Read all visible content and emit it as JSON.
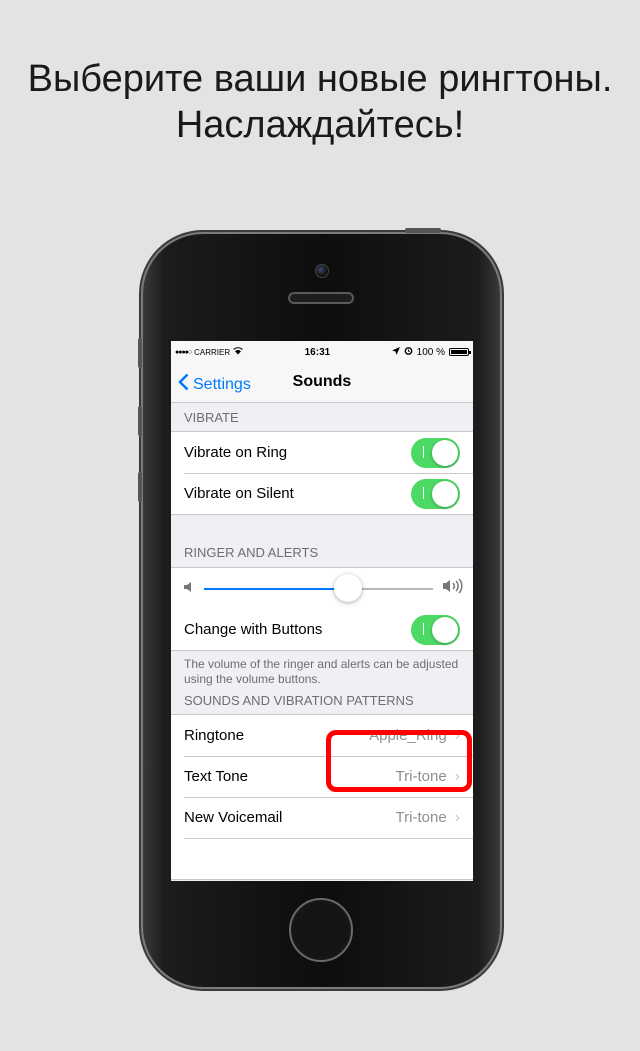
{
  "headline": {
    "line1": "Выберите ваши новые рингтоны.",
    "line2": "Наслаждайтесь!"
  },
  "status_bar": {
    "signal": "●●●●○",
    "carrier": "CARRIER",
    "wifi_icon": "wifi-icon",
    "time": "16:31",
    "location_icon": "location-arrow-icon",
    "alarm_icon": "alarm-icon",
    "battery": "100 %"
  },
  "nav": {
    "back_label": "Settings",
    "title": "Sounds"
  },
  "vibrate": {
    "header": "VIBRATE",
    "rows": [
      {
        "label": "Vibrate on Ring",
        "on": true
      },
      {
        "label": "Vibrate on Silent",
        "on": true
      }
    ]
  },
  "ringer": {
    "header": "RINGER AND ALERTS",
    "volume_level": 0.63,
    "change_with_buttons_label": "Change with Buttons",
    "change_with_buttons_on": true,
    "footer": "The volume of the ringer and alerts can be adjusted using the volume buttons."
  },
  "patterns": {
    "header": "SOUNDS AND VIBRATION PATTERNS",
    "rows": [
      {
        "label": "Ringtone",
        "value": "Apple_Ring"
      },
      {
        "label": "Text Tone",
        "value": "Tri-tone"
      },
      {
        "label": "New Voicemail",
        "value": "Tri-tone"
      }
    ]
  },
  "colors": {
    "accent": "#007aff",
    "toggle_on": "#4cd964",
    "highlight": "#ff0000",
    "background": "#e3e3e3"
  }
}
